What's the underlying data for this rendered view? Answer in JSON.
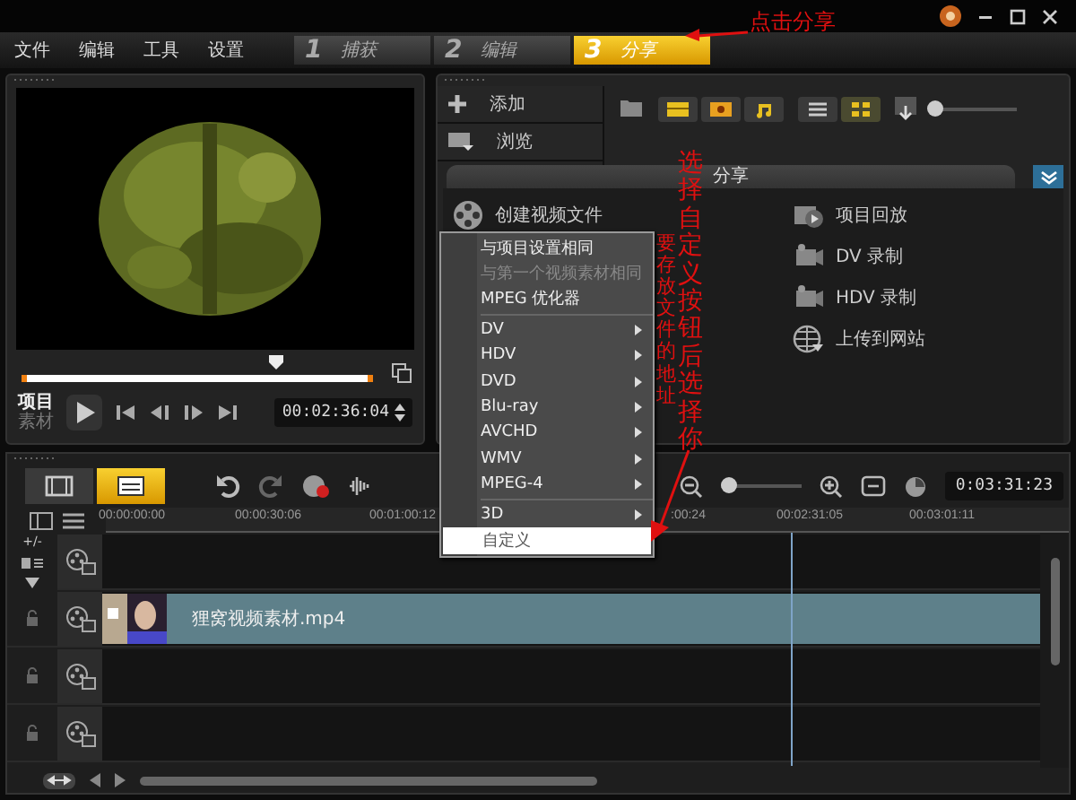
{
  "menu": [
    "文件",
    "编辑",
    "工具",
    "设置"
  ],
  "steps": [
    {
      "number": "1",
      "label": "捕获",
      "selected": false
    },
    {
      "number": "2",
      "label": "编辑",
      "selected": false
    },
    {
      "number": "3",
      "label": "分享",
      "selected": true
    }
  ],
  "preview": {
    "level": 0.73,
    "modes": [
      {
        "label": "项目",
        "selected": true
      },
      {
        "label": "素材",
        "selected": false
      }
    ],
    "timecode": "00:02:36:04"
  },
  "library": {
    "buttons": [
      {
        "kind": "add",
        "label": "添加"
      },
      {
        "kind": "browse",
        "label": "浏览"
      }
    ],
    "views": [
      {
        "kind": "list",
        "selected": false
      },
      {
        "kind": "grid",
        "selected": true
      }
    ],
    "level": 0.05
  },
  "share": {
    "title": "分享",
    "create": "创建视频文件",
    "options": [
      {
        "kind": "playback",
        "label": "项目回放"
      },
      {
        "kind": "camera",
        "label": "DV 录制"
      },
      {
        "kind": "camera",
        "label": "HDV 录制"
      },
      {
        "kind": "globe",
        "label": "上传到网站"
      }
    ]
  },
  "context_menu": [
    {
      "label": "与项目设置相同",
      "disabled": false,
      "submenu": false,
      "selected": false,
      "separator_after": false
    },
    {
      "label": "与第一个视频素材相同",
      "disabled": true,
      "submenu": false,
      "selected": false,
      "separator_after": false
    },
    {
      "label": "MPEG 优化器",
      "disabled": false,
      "submenu": false,
      "selected": false,
      "separator_after": true
    },
    {
      "label": "DV",
      "disabled": false,
      "submenu": true,
      "selected": false,
      "separator_after": false
    },
    {
      "label": "HDV",
      "disabled": false,
      "submenu": true,
      "selected": false,
      "separator_after": false
    },
    {
      "label": "DVD",
      "disabled": false,
      "submenu": true,
      "selected": false,
      "separator_after": false
    },
    {
      "label": "Blu-ray",
      "disabled": false,
      "submenu": true,
      "selected": false,
      "separator_after": false
    },
    {
      "label": "AVCHD",
      "disabled": false,
      "submenu": true,
      "selected": false,
      "separator_after": false
    },
    {
      "label": "WMV",
      "disabled": false,
      "submenu": true,
      "selected": false,
      "separator_after": false
    },
    {
      "label": "MPEG-4",
      "disabled": false,
      "submenu": true,
      "selected": false,
      "separator_after": true
    },
    {
      "label": "3D",
      "disabled": false,
      "submenu": true,
      "selected": false,
      "separator_after": false
    },
    {
      "label": "自定义",
      "disabled": false,
      "submenu": false,
      "selected": true,
      "separator_after": false
    }
  ],
  "timeline": {
    "views": [
      {
        "kind": "storyboard",
        "selected": false
      },
      {
        "kind": "timeline",
        "selected": true
      }
    ],
    "level": 0.1,
    "timecode": "0:03:31:23",
    "ruler": [
      "00:00:00:00",
      "00:00:30:06",
      "00:01:00:12",
      ":00:24",
      "00:02:31:05",
      "00:03:01:11"
    ],
    "track_buttons": "+/-",
    "tracks": [
      {
        "kind": "empty"
      },
      {
        "kind": "clip",
        "clip": "狸窝视频素材.mp4"
      },
      {
        "kind": "empty"
      },
      {
        "kind": "empty"
      }
    ]
  },
  "annotations": [
    "点击分享",
    "选择自定义按钮后选择你",
    "要存放文件的地址"
  ]
}
